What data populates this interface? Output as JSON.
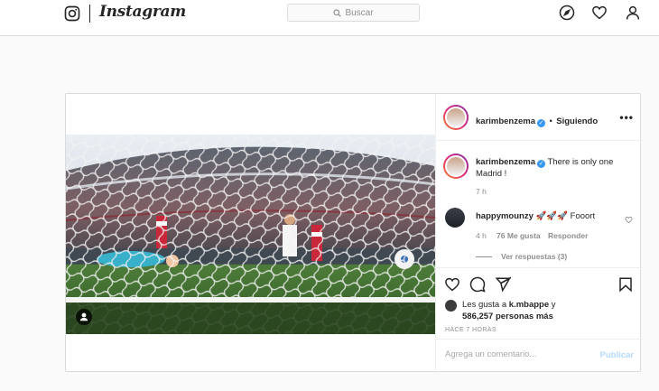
{
  "nav": {
    "logo_text": "Instagram",
    "search_placeholder": "Buscar",
    "icons": [
      "instagram-glyph-icon",
      "search-icon",
      "compass-icon",
      "heart-icon",
      "profile-icon"
    ]
  },
  "post": {
    "author": "karimbenzema",
    "follow_separator": "•",
    "follow_label": "Siguiendo",
    "more_label": "•••",
    "caption": {
      "username": "karimbenzema",
      "text": "There is only one Madrid !",
      "time": "7 h"
    },
    "comments": [
      {
        "username": "happymounzy",
        "text": "🚀🚀🚀 Fooort",
        "time": "4 h",
        "likes": "76 Me gusta",
        "reply_label": "Responder",
        "view_replies": "Ver respuestas (3)"
      }
    ],
    "likes_text_prefix": "Les gusta a",
    "likes_user": "k.mbappe",
    "likes_text_joiner": "y",
    "likes_count": "586,257 personas más",
    "time_ago": "HACE 7 HORAS",
    "comment_placeholder": "Agrega un comentario...",
    "publish_label": "Publicar"
  },
  "colors": {
    "verified": "#3897f0",
    "publish_disabled": "#b3dbff",
    "border": "#dbdbdb",
    "background": "#fafafa"
  }
}
